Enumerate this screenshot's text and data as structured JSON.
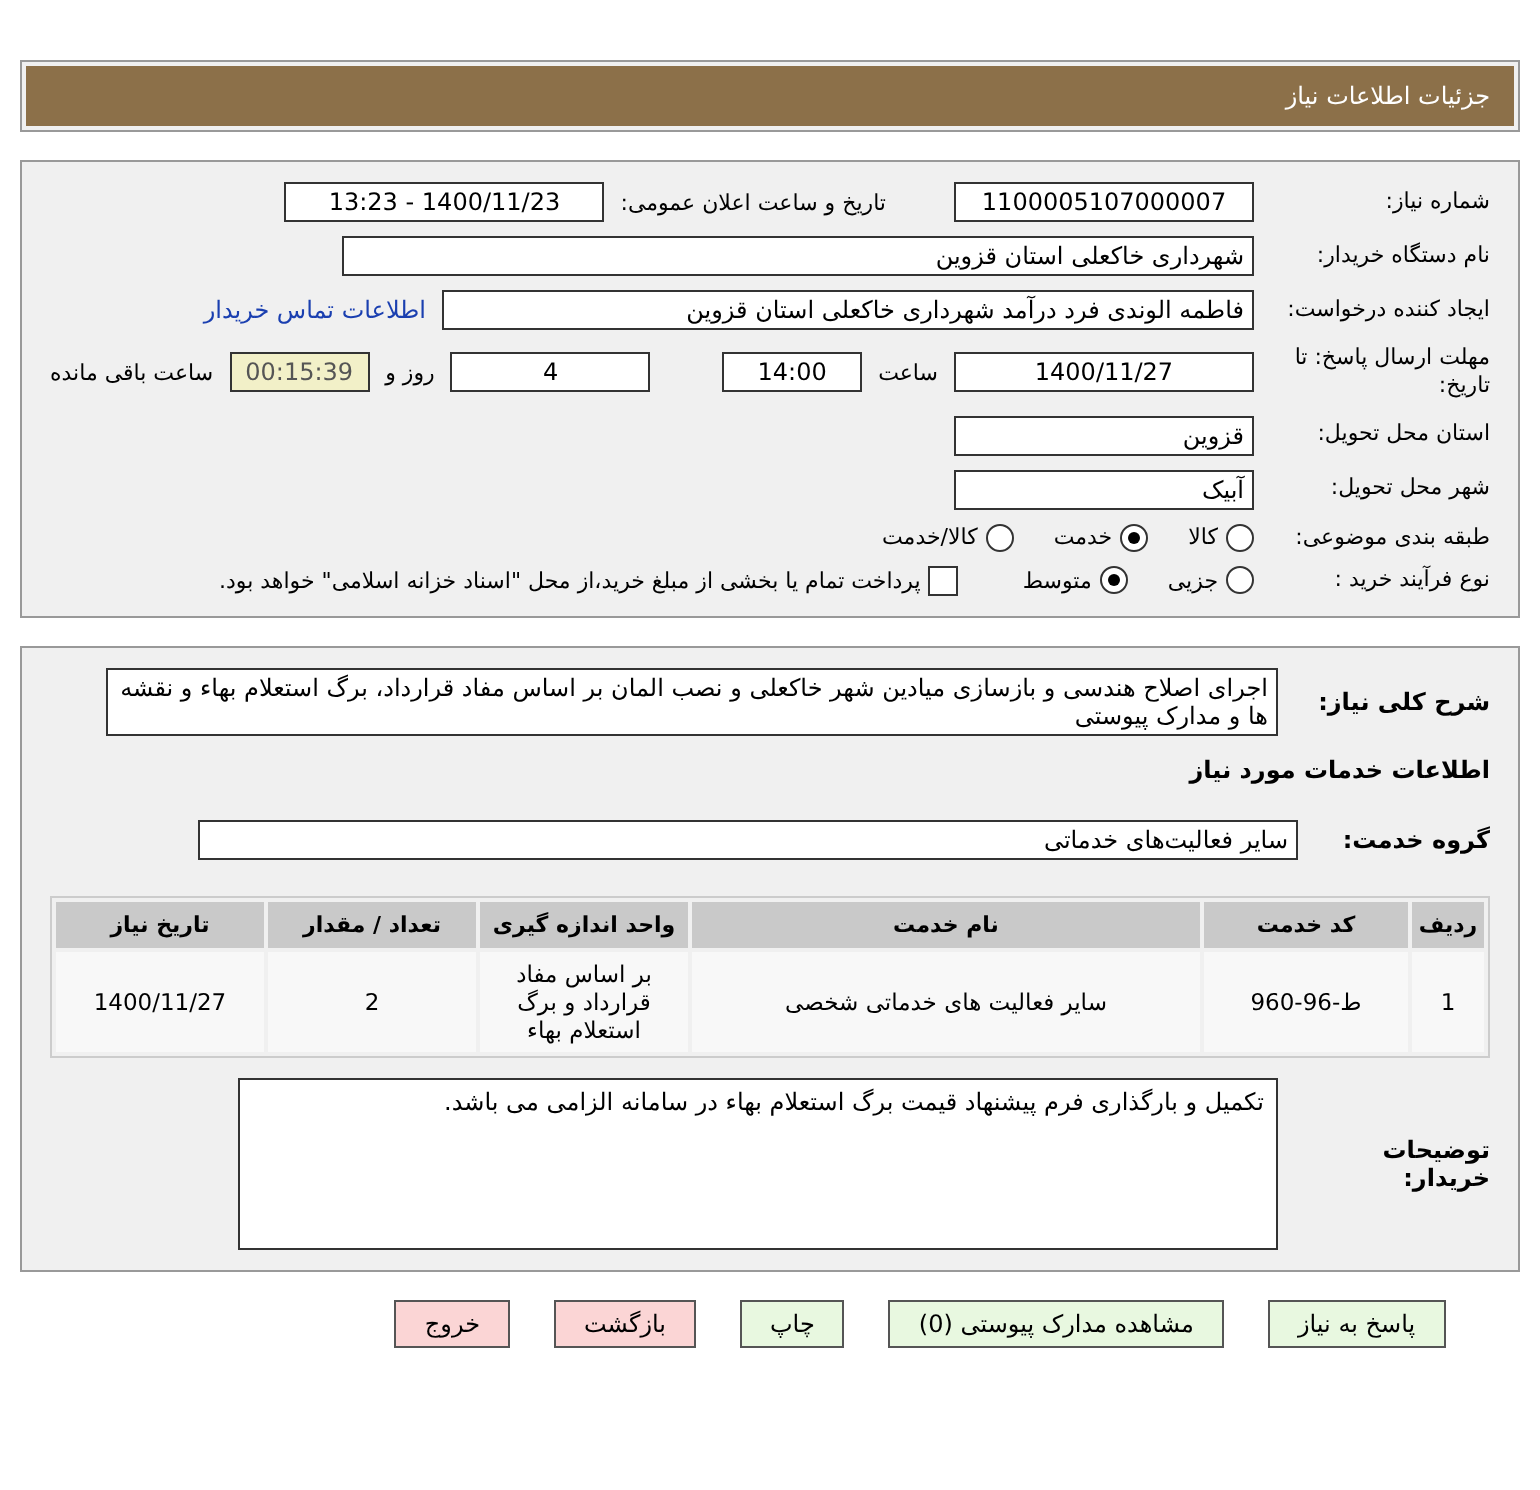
{
  "header": {
    "title": "جزئیات اطلاعات نیاز"
  },
  "details": {
    "need_number": {
      "label": "شماره نیاز:",
      "value": "1100005107000007"
    },
    "announce": {
      "label": "تاریخ و ساعت اعلان عمومی:",
      "value": "1400/11/23 - 13:23"
    },
    "buyer_org": {
      "label": "نام دستگاه خریدار:",
      "value": "شهرداری خاکعلی استان قزوین"
    },
    "requester": {
      "label": "ایجاد کننده درخواست:",
      "value": "فاطمه  الوندی فرد درآمد شهرداری خاکعلی استان قزوین",
      "link": "اطلاعات تماس خریدار"
    },
    "deadline": {
      "label": "مهلت ارسال پاسخ: تا تاریخ:",
      "date": "1400/11/27",
      "time_label": "ساعت",
      "time": "14:00",
      "days": "4",
      "days_label": "روز و",
      "remaining": "00:15:39",
      "remaining_label": "ساعت باقی مانده"
    },
    "province": {
      "label": "استان محل تحویل:",
      "value": "قزوین"
    },
    "city": {
      "label": "شهر محل تحویل:",
      "value": "آبیک"
    },
    "category": {
      "label": "طبقه بندی موضوعی:",
      "options": [
        {
          "label": "کالا",
          "selected": false
        },
        {
          "label": "خدمت",
          "selected": true
        },
        {
          "label": "کالا/خدمت",
          "selected": false
        }
      ]
    },
    "process": {
      "label": "نوع فرآیند خرید :",
      "options": [
        {
          "label": "جزیی",
          "selected": false
        },
        {
          "label": "متوسط",
          "selected": true
        }
      ],
      "payment": {
        "label": "پرداخت تمام یا بخشی از مبلغ خرید،از محل \"اسناد خزانه اسلامی\" خواهد بود.",
        "checked": false
      }
    }
  },
  "summary": {
    "label": "شرح کلی نیاز:",
    "value": "اجرای اصلاح هندسی و بازسازی میادین شهر خاکعلی و نصب المان بر اساس مفاد قرارداد، برگ استعلام بهاء و نقشه ها و مدارک پیوستی"
  },
  "services_title": "اطلاعات خدمات مورد نیاز",
  "service_group": {
    "label": "گروه خدمت:",
    "value": "سایر فعالیت‌های خدماتی"
  },
  "table": {
    "columns": [
      "ردیف",
      "کد خدمت",
      "نام خدمت",
      "واحد اندازه گیری",
      "تعداد / مقدار",
      "تاریخ نیاز"
    ],
    "rows": [
      [
        "1",
        "ط-96-960",
        "سایر فعالیت های خدماتی شخصی",
        "بر اساس مفاد قرارداد و برگ استعلام بهاء",
        "2",
        "1400/11/27"
      ]
    ]
  },
  "buyer_notes": {
    "label": "توضیحات خریدار:",
    "value": "تکمیل و بارگذاری فرم پیشنهاد قیمت برگ استعلام بهاء در سامانه الزامی می باشد."
  },
  "buttons": [
    {
      "label": "پاسخ به نیاز",
      "kind": "normal"
    },
    {
      "label": "مشاهده مدارک پیوستی (0)",
      "kind": "normal"
    },
    {
      "label": "چاپ",
      "kind": "normal"
    },
    {
      "label": "بازگشت",
      "kind": "alert"
    },
    {
      "label": "خروج",
      "kind": "alert"
    }
  ]
}
